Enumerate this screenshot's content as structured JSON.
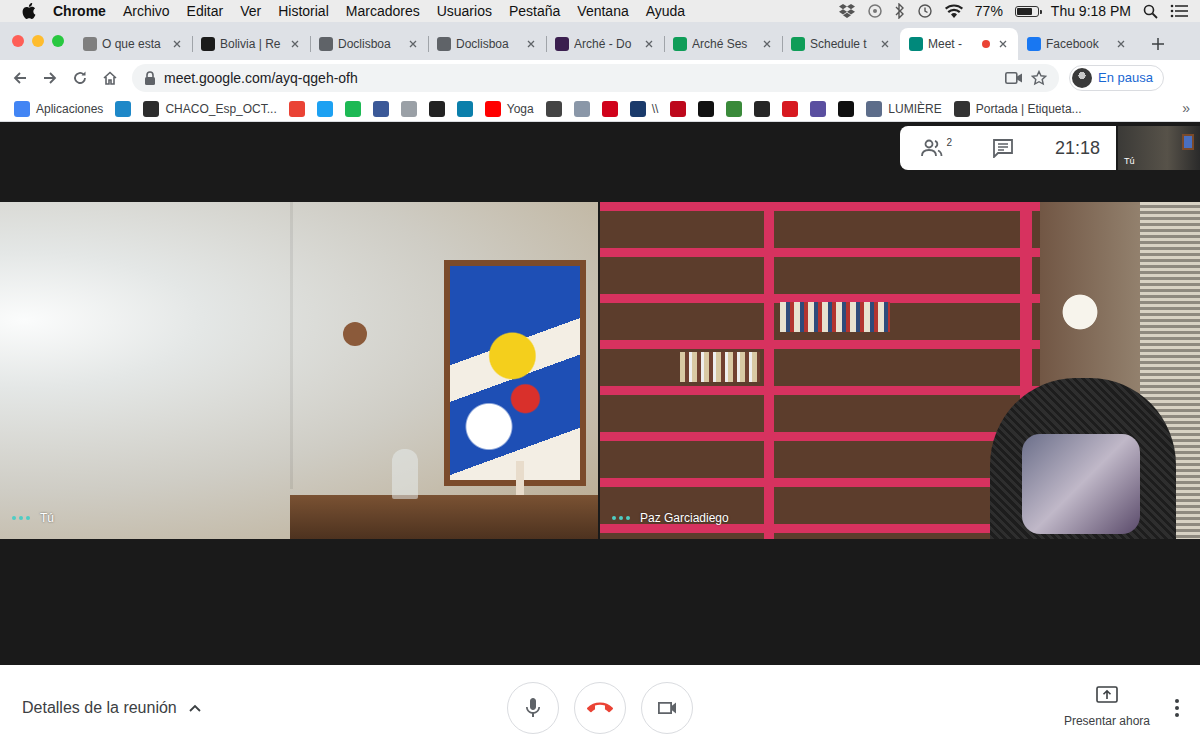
{
  "menu_bar": {
    "app": "Chrome",
    "items": [
      "Archivo",
      "Editar",
      "Ver",
      "Historial",
      "Marcadores",
      "Usuarios",
      "Pestaña",
      "Ventana",
      "Ayuda"
    ],
    "battery": "77%",
    "battery_level": 0.77,
    "clock": "Thu 9:18 PM"
  },
  "tabs": [
    {
      "label": "O que esta",
      "selected": false,
      "recording": false,
      "color": "#7f7f7f"
    },
    {
      "label": "Bolivia | Re",
      "selected": false,
      "recording": false,
      "color": "#1b1b1b"
    },
    {
      "label": "Doclisboa",
      "selected": false,
      "recording": false,
      "color": "#5f6368"
    },
    {
      "label": "Doclisboa",
      "selected": false,
      "recording": false,
      "color": "#5f6368"
    },
    {
      "label": "Arché - Do",
      "selected": false,
      "recording": false,
      "color": "#3b1f4f"
    },
    {
      "label": "Arché Ses",
      "selected": false,
      "recording": false,
      "color": "#0f9d58"
    },
    {
      "label": "Schedule t",
      "selected": false,
      "recording": false,
      "color": "#0f9d58"
    },
    {
      "label": "Meet -",
      "selected": true,
      "recording": true,
      "color": "#00897b"
    },
    {
      "label": "Facebook",
      "selected": false,
      "recording": false,
      "color": "#1877f2"
    }
  ],
  "address_bar": {
    "url": "meet.google.com/ayq-qgeh-ofh",
    "profile": "En pausa"
  },
  "bookmarks": [
    {
      "label": "Aplicaciones",
      "color": "#4285f4"
    },
    {
      "color": "#1e88c8"
    },
    {
      "label": "CHACO_Esp_OCT...",
      "color": "#2d2d2d"
    },
    {
      "color": "#ea4335"
    },
    {
      "color": "#1da1f2"
    },
    {
      "color": "#1db954"
    },
    {
      "color": "#3b5998"
    },
    {
      "color": "#9aa0a6"
    },
    {
      "color": "#222222"
    },
    {
      "color": "#0b7fab"
    },
    {
      "label": "Yoga",
      "color": "#ff0000"
    },
    {
      "color": "#444444"
    },
    {
      "color": "#8a97a8"
    },
    {
      "color": "#d0021b"
    },
    {
      "label": "\\\\",
      "color": "#1a3a6b"
    },
    {
      "color": "#bd081c"
    },
    {
      "color": "#111111"
    },
    {
      "color": "#3a8a3a"
    },
    {
      "color": "#262626"
    },
    {
      "color": "#d71920"
    },
    {
      "color": "#5a4fa0"
    },
    {
      "color": "#101010"
    },
    {
      "label": "LUMIÈRE",
      "color": "#5d6d8a"
    },
    {
      "label": "Portada | Etiqueta...",
      "color": "#333333"
    }
  ],
  "bookmarks_overflow": "»",
  "meet": {
    "participants": "2",
    "clock": "21:18",
    "self_view_label": "Tú",
    "tiles": [
      {
        "name": "Tú"
      },
      {
        "name": "Paz Garciadiego"
      }
    ],
    "details": "Detalles de la reunión",
    "details_expanded": false,
    "controls": {
      "mic_on": true,
      "camera_on": true
    },
    "present": "Presentar ahora"
  }
}
